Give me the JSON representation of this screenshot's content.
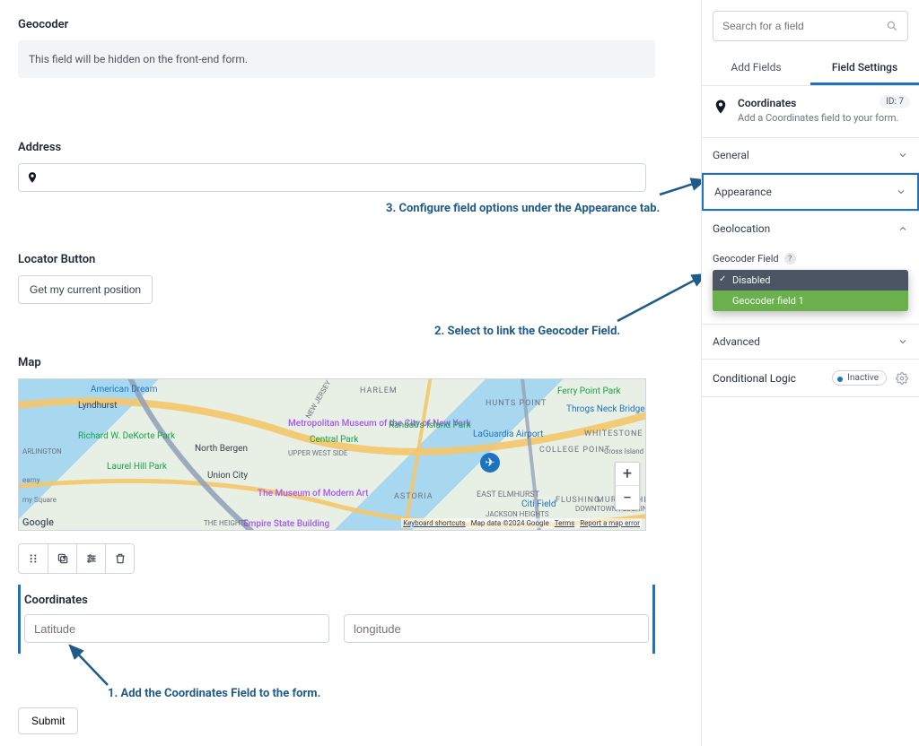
{
  "main": {
    "geocoder": {
      "label": "Geocoder",
      "hidden_msg": "This field will be hidden on the front-end form."
    },
    "address": {
      "label": "Address"
    },
    "locator": {
      "label": "Locator Button",
      "button": "Get my current position"
    },
    "map": {
      "label": "Map",
      "places": {
        "lyndhurst": "Lyndhurst",
        "american_dream": "American Dream",
        "richard": "Richard W. DeKorte Park",
        "laurel_hill": "Laurel Hill Park",
        "north_bergen": "North Bergen",
        "union_city": "Union City",
        "harlem": "HARLEM",
        "astoria": "ASTORIA",
        "met": "Metropolitan Museum of the City of New York",
        "moma": "The Museum of Modern Art",
        "esb": "Empire State Building",
        "randalls": "Randall's Island Park",
        "central_park": "Central Park",
        "laguardia": "LaGuardia Airport",
        "citi": "Citi Field",
        "flushing": "FLUSHING",
        "east_elm": "EAST ELMHURST",
        "jackson": "JACKSON HEIGHTS",
        "throgs": "Throgs Neck Bridge",
        "whitestone": "WHITESTONE",
        "college_pt": "COLLEGE POINT",
        "murray": "MURRAY HILL",
        "hunts": "HUNTS POINT",
        "ferry": "Ferry Point Park",
        "upper_ws": "UPPER WEST SIDE",
        "newj": "NEW JERSEY",
        "heights": "THE HEIGHTS",
        "arlington": "ARLINGTON",
        "square": "rny Square",
        "cross": "Cross Island Pkwy",
        "downtown_fl": "DOWNTOWN FLUSHING",
        "kearny": "earny"
      },
      "footer": {
        "google": "Google",
        "shortcuts": "Keyboard shortcuts",
        "mapdata": "Map data ©2024 Google",
        "terms": "Terms",
        "report": "Report a map error"
      }
    },
    "coordinates": {
      "label": "Coordinates",
      "lat_placeholder": "Latitude",
      "lng_placeholder": "longitude"
    },
    "submit_label": "Submit"
  },
  "annotations": {
    "step1": "1. Add the Coordinates Field to the form.",
    "step2": "2. Select to link the Geocoder Field.",
    "step3": "3. Configure field options under the Appearance tab."
  },
  "sidebar": {
    "search_placeholder": "Search for a field",
    "tabs": {
      "add": "Add Fields",
      "settings": "Field Settings"
    },
    "field": {
      "title": "Coordinates",
      "id_badge": "ID: 7",
      "desc": "Add a Coordinates field to your form."
    },
    "sections": {
      "general": "General",
      "appearance": "Appearance",
      "geolocation": "Geolocation",
      "geocoder_field_label": "Geocoder Field",
      "dd_disabled": "Disabled",
      "dd_geocoder1": "Geocoder field 1",
      "advanced": "Advanced",
      "conditional": "Conditional Logic",
      "inactive": "Inactive"
    }
  }
}
